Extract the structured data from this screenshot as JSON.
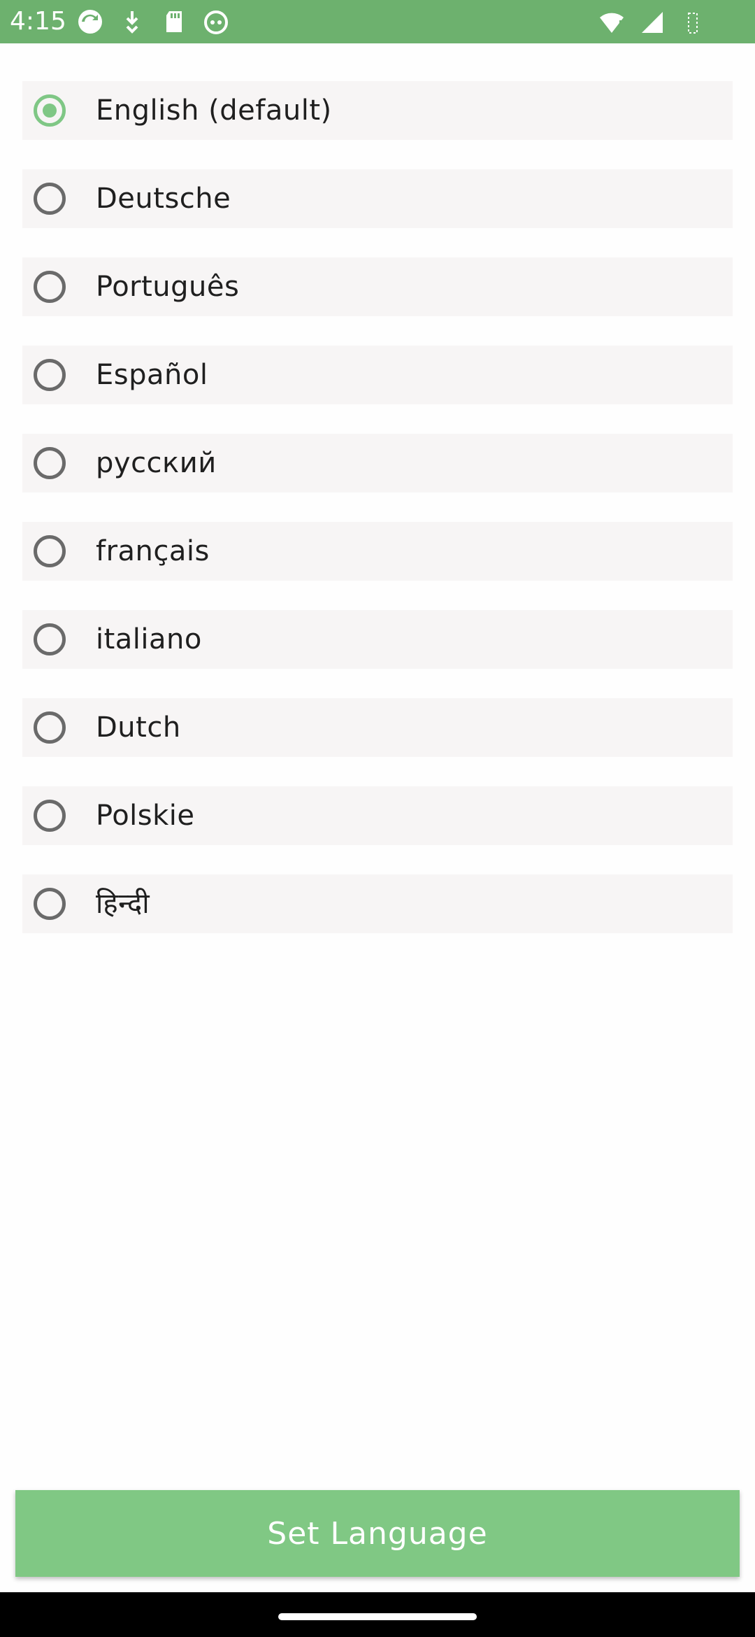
{
  "status_bar": {
    "time": "4:15",
    "left_icons": [
      "sync-icon",
      "download-icon",
      "sd-card-icon",
      "app-face-icon"
    ],
    "right_icons": [
      "wifi-alert-icon",
      "signal-icon",
      "battery-icon"
    ]
  },
  "languages": [
    {
      "label": "English (default)",
      "selected": true
    },
    {
      "label": "Deutsche",
      "selected": false
    },
    {
      "label": "Português",
      "selected": false
    },
    {
      "label": "Español",
      "selected": false
    },
    {
      "label": "русский",
      "selected": false
    },
    {
      "label": "français",
      "selected": false
    },
    {
      "label": "italiano",
      "selected": false
    },
    {
      "label": "Dutch",
      "selected": false
    },
    {
      "label": "Polskie",
      "selected": false
    },
    {
      "label": "हिन्दी",
      "selected": false
    }
  ],
  "set_button": {
    "label": "Set Language"
  },
  "colors": {
    "status_bar": "#6db16e",
    "accent": "#7fc785",
    "button": "#80c884",
    "item_background": "#f7f5f5"
  }
}
